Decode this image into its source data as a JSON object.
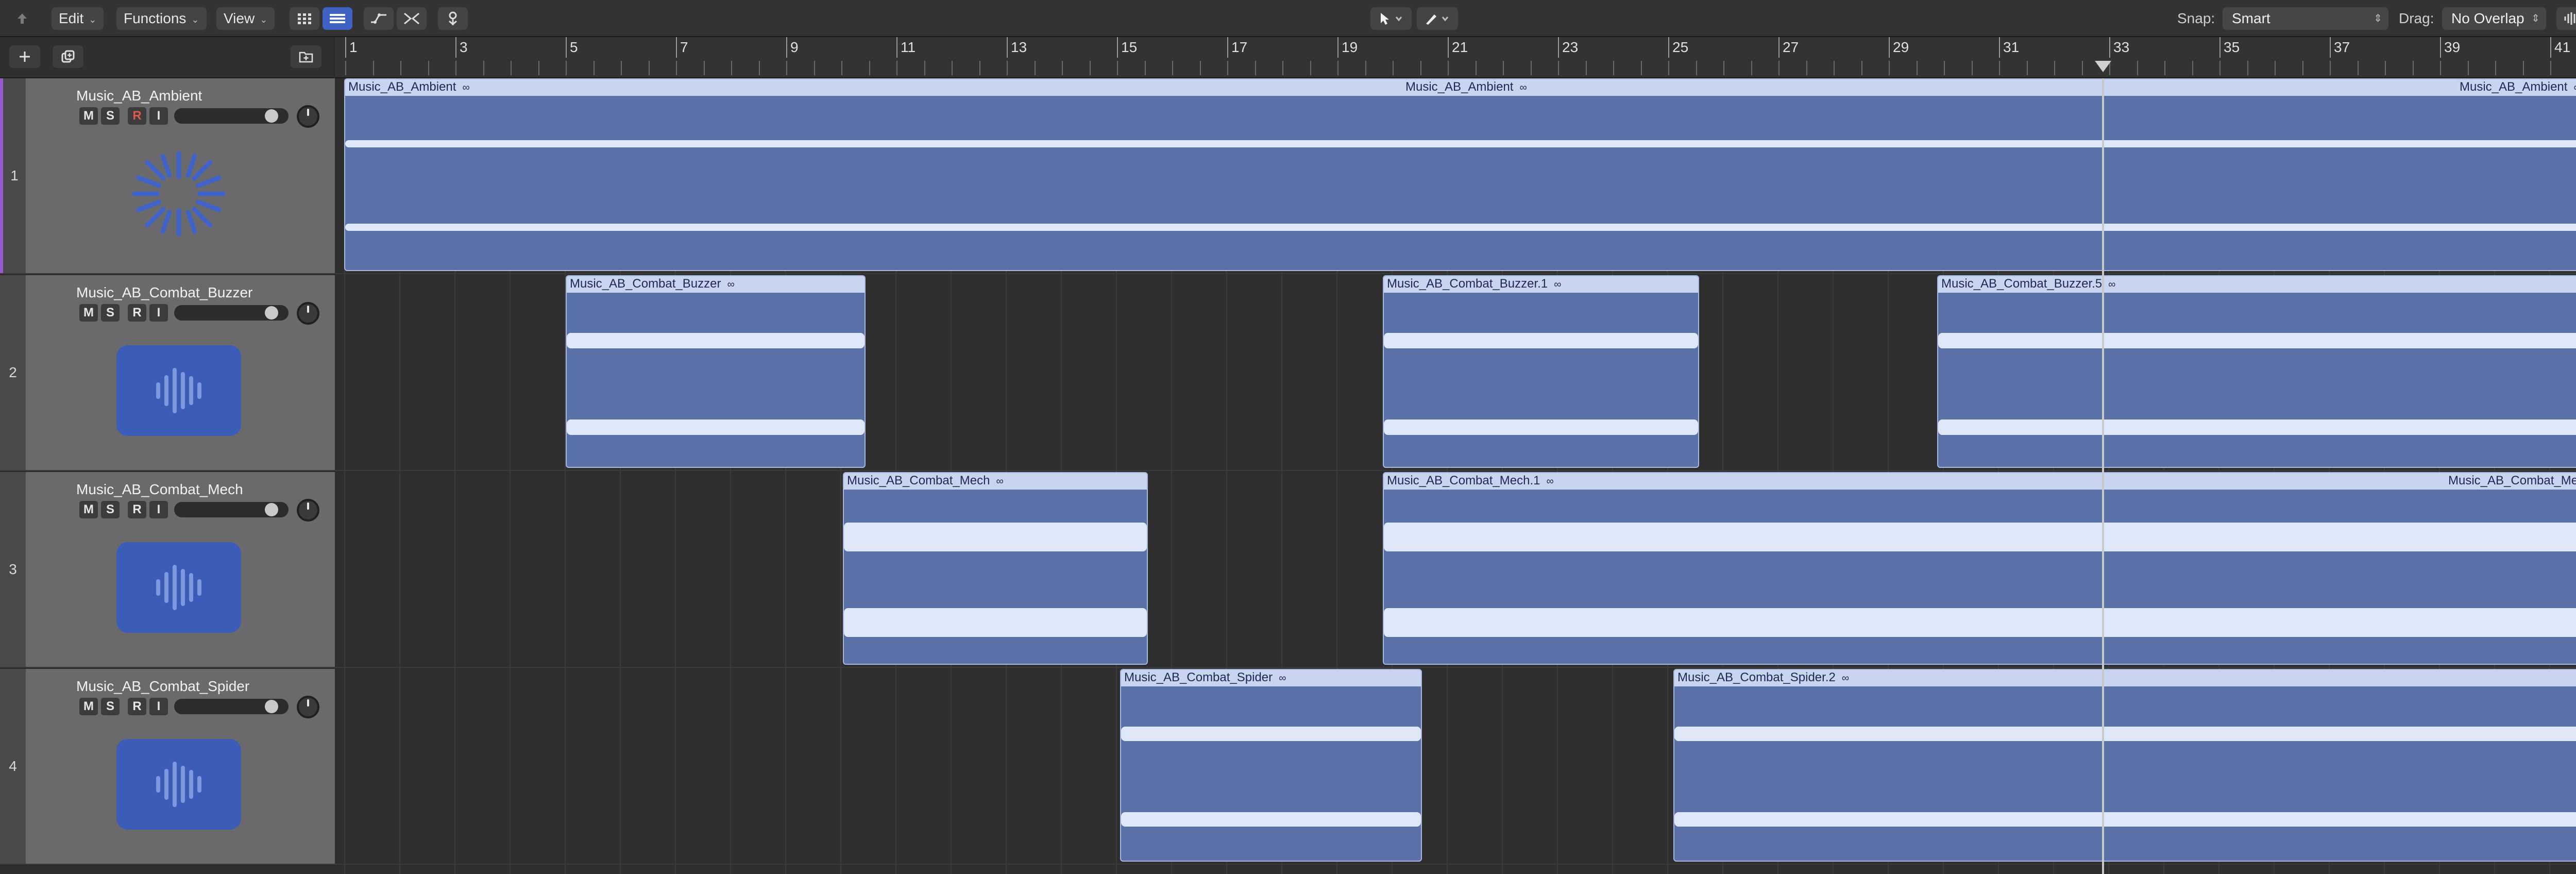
{
  "toolbar": {
    "edit_label": "Edit",
    "functions_label": "Functions",
    "view_label": "View",
    "snap_label": "Snap:",
    "snap_value": "Smart",
    "drag_label": "Drag:",
    "drag_value": "No Overlap"
  },
  "ruler": {
    "bars": [
      "1",
      "3",
      "5",
      "7",
      "9",
      "11",
      "13",
      "15",
      "17",
      "19",
      "21",
      "23",
      "25",
      "27",
      "29",
      "31",
      "33",
      "35",
      "37",
      "39",
      "41"
    ]
  },
  "tracks": [
    {
      "number": "1",
      "name": "Music_AB_Ambient",
      "mute": "M",
      "solo": "S",
      "record": "R",
      "input": "I"
    },
    {
      "number": "2",
      "name": "Music_AB_Combat_Buzzer",
      "mute": "M",
      "solo": "S",
      "record": "R",
      "input": "I"
    },
    {
      "number": "3",
      "name": "Music_AB_Combat_Mech",
      "mute": "M",
      "solo": "S",
      "record": "R",
      "input": "I"
    },
    {
      "number": "4",
      "name": "Music_AB_Combat_Spider",
      "mute": "M",
      "solo": "S",
      "record": "R",
      "input": "I"
    }
  ],
  "regions": {
    "ambient": {
      "name": "Music_AB_Ambient",
      "loop_icon": "∞"
    },
    "buzzer_1": {
      "name": "Music_AB_Combat_Buzzer"
    },
    "buzzer_2": {
      "name": "Music_AB_Combat_Buzzer.1"
    },
    "buzzer_3": {
      "name": "Music_AB_Combat_Buzzer.5"
    },
    "mech_1": {
      "name": "Music_AB_Combat_Mech"
    },
    "mech_2": {
      "name": "Music_AB_Combat_Mech.1"
    },
    "spider_1": {
      "name": "Music_AB_Combat_Spider"
    },
    "spider_2": {
      "name": "Music_AB_Combat_Spider.2"
    }
  },
  "colors": {
    "region": "#5a72a8",
    "region_header": "#c9d4f0",
    "accent": "#3f62c4"
  }
}
